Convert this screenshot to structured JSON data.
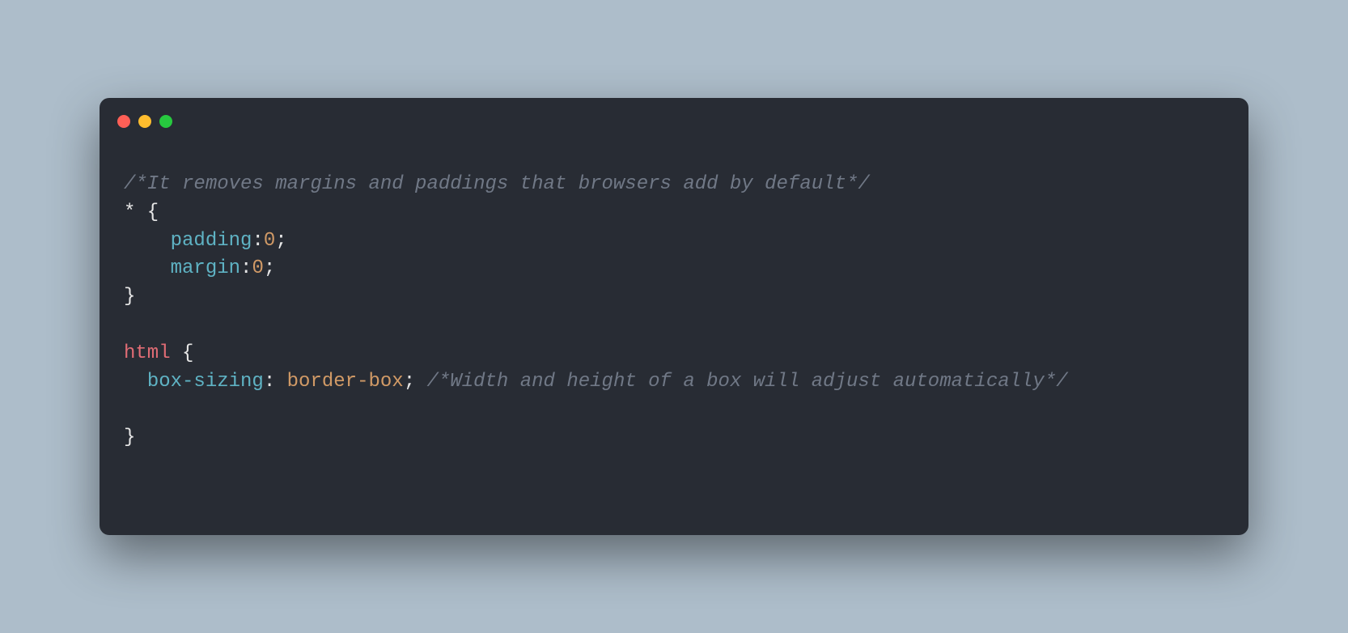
{
  "code": {
    "line1_comment": "/*It removes margins and paddings that browsers add by default*/",
    "line2_selector": "*",
    "line2_brace": " {",
    "line3_indent": "    ",
    "line3_prop": "padding",
    "line3_colon": ":",
    "line3_val": "0",
    "line3_semi": ";",
    "line4_indent": "    ",
    "line4_prop": "margin",
    "line4_colon": ":",
    "line4_val": "0",
    "line4_semi": ";",
    "line5_brace": "}",
    "line7_selector": "html",
    "line7_brace": " {",
    "line8_indent": "  ",
    "line8_prop": "box-sizing",
    "line8_colon": ": ",
    "line8_val": "border-box",
    "line8_semi": ";",
    "line8_space": " ",
    "line8_comment": "/*Width and height of a box will adjust automatically*/",
    "line10_brace": "}"
  },
  "colors": {
    "background": "#adbdca",
    "editor_bg": "#282c34",
    "comment": "#707886",
    "property": "#5fb3c4",
    "value": "#d19a66",
    "tag": "#e06c75",
    "text": "#e6e6e6",
    "red": "#ff5f56",
    "yellow": "#ffbd2e",
    "green": "#27c93f"
  }
}
